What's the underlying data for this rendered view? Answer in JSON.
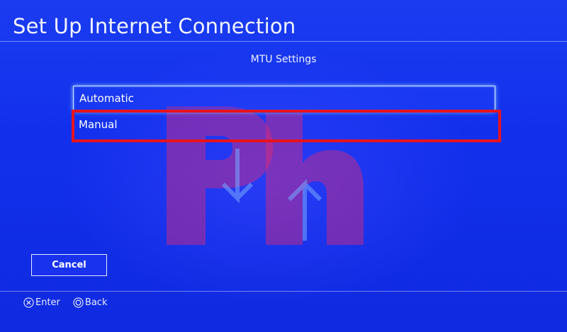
{
  "header": {
    "title": "Set Up Internet Connection"
  },
  "main": {
    "subtitle": "MTU Settings",
    "options": [
      {
        "label": "Automatic",
        "focused": true
      },
      {
        "label": "Manual",
        "focused": false,
        "highlighted": true
      }
    ],
    "cancel_label": "Cancel"
  },
  "footer": {
    "hints": [
      {
        "icon": "cross-button-icon",
        "label": "Enter"
      },
      {
        "icon": "circle-button-icon",
        "label": "Back"
      }
    ]
  },
  "colors": {
    "background": "#1230ec",
    "highlight_box": "#e8131c",
    "text": "#ffffff"
  }
}
